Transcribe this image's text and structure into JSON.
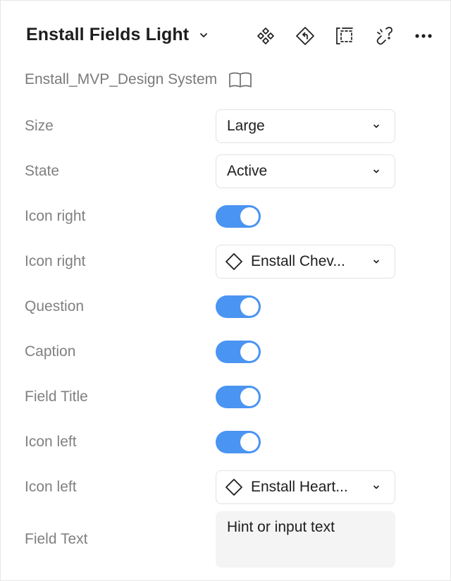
{
  "header": {
    "title": "Enstall Fields Light",
    "icons": [
      "component-icon",
      "reset-icon",
      "select-layer-icon",
      "detach-icon",
      "more-icon"
    ]
  },
  "library": {
    "name": "Enstall_MVP_Design System",
    "icon": "book-icon"
  },
  "properties": [
    {
      "label": "Size",
      "type": "select",
      "value": "Large"
    },
    {
      "label": "State",
      "type": "select",
      "value": "Active"
    },
    {
      "label": "Icon right",
      "type": "toggle",
      "on": true
    },
    {
      "label": "Icon right",
      "type": "instance-select",
      "value": "Enstall Chev..."
    },
    {
      "label": "Question",
      "type": "toggle",
      "on": true
    },
    {
      "label": "Caption",
      "type": "toggle",
      "on": true
    },
    {
      "label": "Field Title",
      "type": "toggle",
      "on": true
    },
    {
      "label": "Icon left",
      "type": "toggle",
      "on": true
    },
    {
      "label": "Icon left",
      "type": "instance-select",
      "value": "Enstall Heart..."
    },
    {
      "label": "Field Text",
      "type": "text",
      "value": "Hint or input text"
    }
  ],
  "colors": {
    "toggle_on": "#4a94f2",
    "label": "#808080",
    "text": "#1e1e1e"
  }
}
